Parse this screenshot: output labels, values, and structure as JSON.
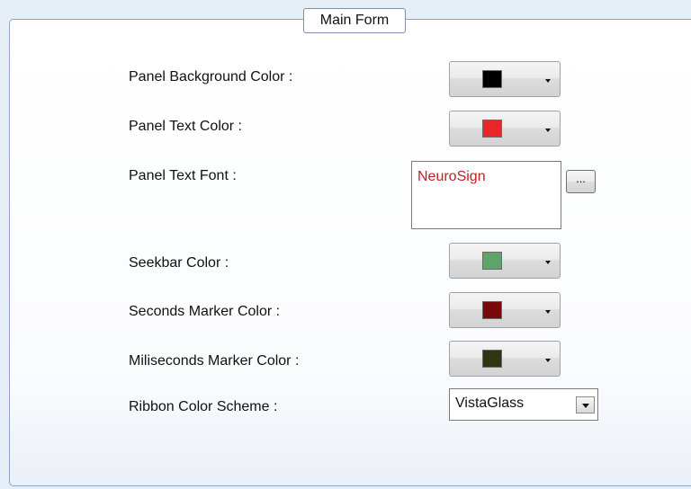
{
  "group": {
    "title": "Main Form"
  },
  "fields": {
    "panel_bg_label": "Panel Background Color :",
    "panel_text_color_label": "Panel Text Color :",
    "panel_text_font_label": "Panel Text Font :",
    "seekbar_color_label": "Seekbar Color :",
    "seconds_marker_label": "Seconds Marker Color :",
    "miliseconds_marker_label": "Miliseconds Marker Color :",
    "ribbon_scheme_label": "Ribbon Color Scheme :"
  },
  "colors": {
    "panel_background": "#000000",
    "panel_text": "#e8262a",
    "seekbar": "#5fa36a",
    "seconds_marker": "#7a0a0a",
    "miliseconds_marker": "#2f3510"
  },
  "font": {
    "preview_text": "NeuroSign",
    "browse_label": "..."
  },
  "ribbon": {
    "selected": "VistaGlass"
  },
  "icons": {
    "dropdown": "chevron-down-icon"
  }
}
